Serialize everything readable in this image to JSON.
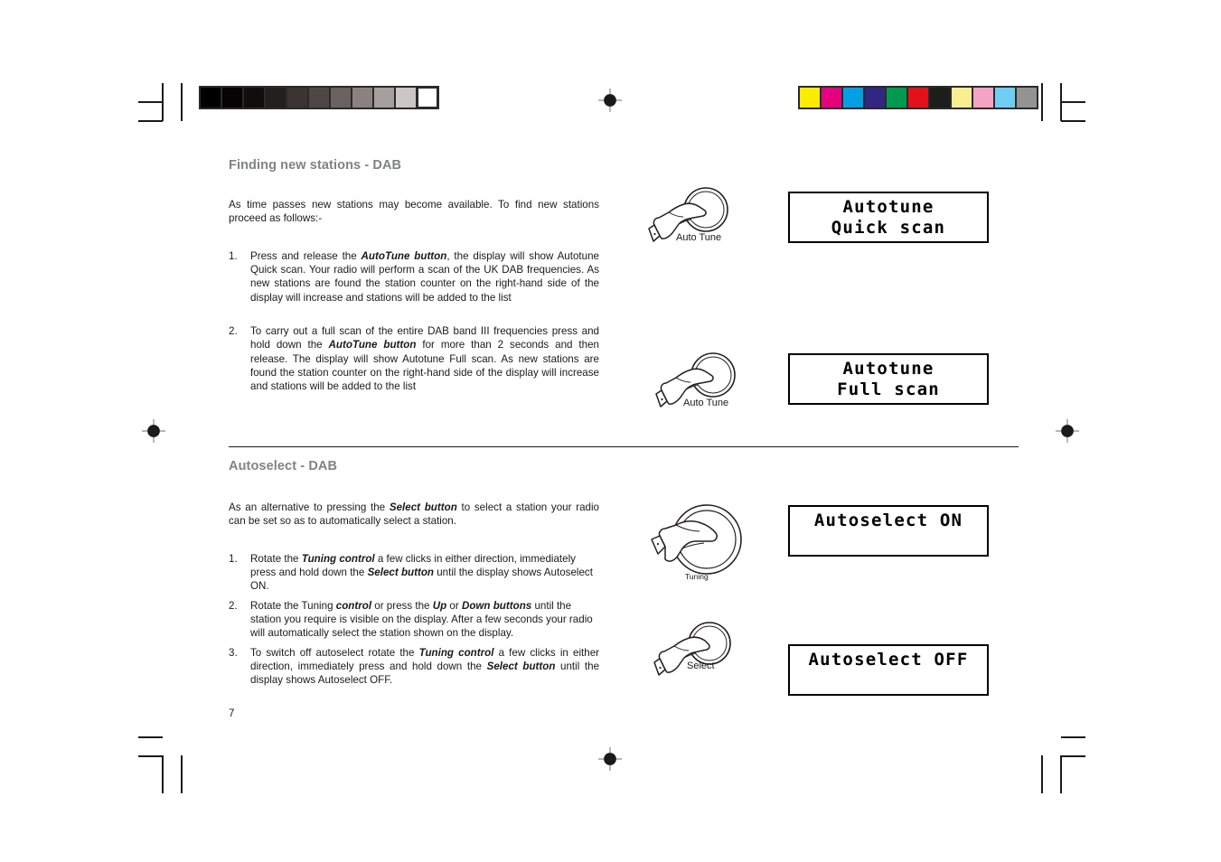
{
  "document": {
    "page_number": "7",
    "sections": [
      {
        "heading": "Finding new stations - DAB",
        "intro": "As time passes new stations may become available. To find new stations proceed as follows:-",
        "steps": [
          {
            "number": "1.",
            "pre": "Press and release the ",
            "bold": "AutoTune button",
            "post": ", the display will show Autotune Quick scan. Your radio will perform a scan of the UK DAB frequencies. As new stations are found the station counter on the right-hand side of the display will increase and stations will be added to the list"
          },
          {
            "number": "2.",
            "pre": "To carry out a full scan of the entire DAB band III frequencies press and hold down the ",
            "bold": "AutoTune button",
            "post": " for more than 2 seconds and then release. The display will show Autotune Full scan. As new stations are found the station counter on the right-hand side of the display will increase and stations will be added to the list"
          }
        ]
      },
      {
        "heading": "Autoselect - DAB",
        "intro_pre": "As an alternative to pressing the ",
        "intro_bold": "Select button",
        "intro_post": " to select a station your radio can be set so as to automatically select a station.",
        "steps": [
          {
            "number": "1.",
            "p1": "Rotate the ",
            "b1": "Tuning control",
            "p2": " a few clicks in either direction, immediately press and hold down the ",
            "b2": "Select button",
            "p3": " until the display shows Autoselect ON."
          },
          {
            "number": "2.",
            "p1": "Rotate the Tuning ",
            "b1": "control",
            "p2": " or press the ",
            "b2": "Up",
            "p3": " or ",
            "b3": "Down buttons",
            "p4": " until the station you require is visible on the display. After a few seconds your radio will automatically select the station shown on the display."
          },
          {
            "number": "3.",
            "p1": "To switch off autoselect rotate the ",
            "b1": "Tuning control",
            "p2": " a few clicks in either direction, immediately press and hold down the ",
            "b2": "Select button",
            "p3": " until the display shows Autoselect OFF."
          }
        ]
      }
    ]
  },
  "displays": [
    {
      "name": "autotune-quick-scan",
      "line1": "Autotune",
      "line2": "Quick scan"
    },
    {
      "name": "autotune-full-scan",
      "line1": "Autotune",
      "line2": "Full scan"
    },
    {
      "name": "autoselect-on",
      "line1": "Autoselect ON",
      "line2": ""
    },
    {
      "name": "autoselect-off",
      "line1": "Autoselect OFF",
      "line2": ""
    }
  ],
  "illustrations": [
    {
      "name": "auto-tune-button-press-1",
      "label": "Auto Tune"
    },
    {
      "name": "auto-tune-button-press-2",
      "label": "Auto Tune"
    },
    {
      "name": "tuning-control-rotate",
      "label": "Tuning"
    },
    {
      "name": "select-button-press",
      "label": "Select"
    }
  ],
  "print_marks": {
    "grayscale_bar": [
      "#000000",
      "#050303",
      "#110d0b",
      "#231f1d",
      "#3b3431",
      "#4f4744",
      "#6b625f",
      "#8b817e",
      "#a6a09d",
      "#cbc7c5",
      "#ffffff"
    ],
    "color_bar": [
      "#fced00",
      "#e5007e",
      "#00a0e3",
      "#312783",
      "#009a4e",
      "#e3121a",
      "#1d1d1b",
      "#faee90",
      "#f4a3c4",
      "#6fcdf2",
      "#939393"
    ]
  }
}
